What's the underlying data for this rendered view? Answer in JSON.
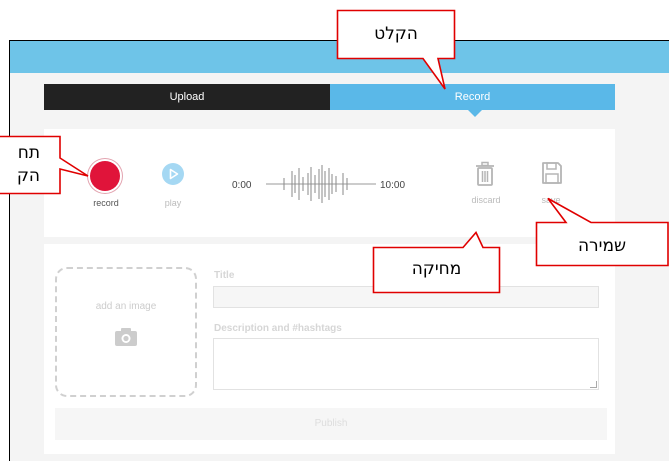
{
  "tabs": {
    "upload": "Upload",
    "record": "Record"
  },
  "recorder": {
    "record_label": "record",
    "play_label": "play",
    "time_start": "0:00",
    "time_end": "10:00",
    "discard_label": "discard",
    "save_label": "save"
  },
  "form": {
    "add_image_label": "add an image",
    "title_label": "Title",
    "description_label": "Description and #hashtags",
    "publish_label": "Publish"
  },
  "annotations": {
    "recording": "הקלט",
    "start_recording": "תח",
    "start_recording_line2": "הק",
    "delete": "מחיקה",
    "save": "שמירה"
  },
  "colors": {
    "header": "#6ec4e8",
    "upload_tab": "#222222",
    "record_tab": "#5ab8e8",
    "record_button": "#e0143a",
    "play_button": "#a5d8f3",
    "callout_border": "#e00000"
  }
}
